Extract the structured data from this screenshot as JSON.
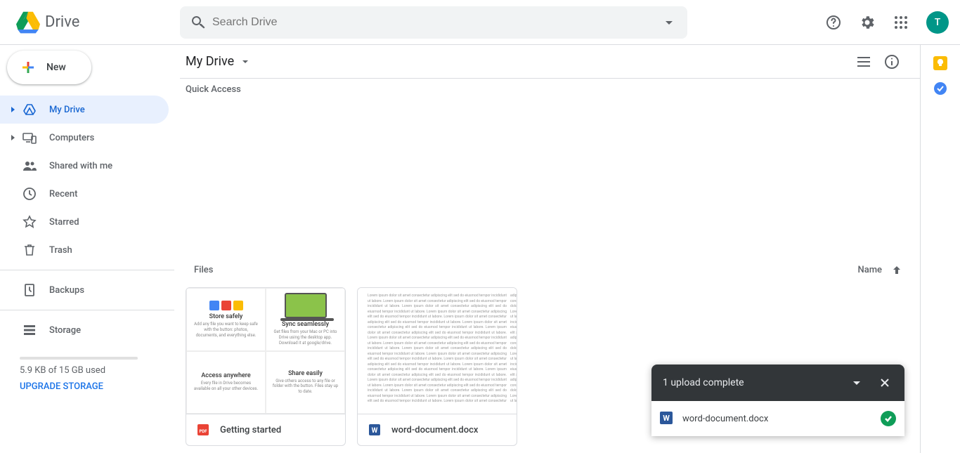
{
  "header": {
    "product_name": "Drive",
    "search_placeholder": "Search Drive",
    "avatar_initial": "T"
  },
  "sidebar": {
    "new_label": "New",
    "items": [
      {
        "label": "My Drive",
        "icon": "drive-hq-icon",
        "expandable": true,
        "active": true
      },
      {
        "label": "Computers",
        "icon": "devices-icon",
        "expandable": true,
        "active": false
      },
      {
        "label": "Shared with me",
        "icon": "people-icon",
        "expandable": false,
        "active": false
      },
      {
        "label": "Recent",
        "icon": "clock-icon",
        "expandable": false,
        "active": false
      },
      {
        "label": "Starred",
        "icon": "star-icon",
        "expandable": false,
        "active": false
      },
      {
        "label": "Trash",
        "icon": "trash-icon",
        "expandable": false,
        "active": false
      }
    ],
    "backups_label": "Backups",
    "storage_label": "Storage",
    "storage_used": "5.9 KB of 15 GB used",
    "upgrade_label": "UPGRADE STORAGE"
  },
  "main": {
    "breadcrumb": "My Drive",
    "quick_access_label": "Quick Access",
    "files_label": "Files",
    "name_column": "Name",
    "sort_direction": "asc",
    "files": [
      {
        "name": "Getting started",
        "type": "pdf"
      },
      {
        "name": "word-document.docx",
        "type": "word"
      }
    ]
  },
  "upload_toast": {
    "title": "1 upload complete",
    "file_name": "word-document.docx",
    "status": "complete"
  }
}
